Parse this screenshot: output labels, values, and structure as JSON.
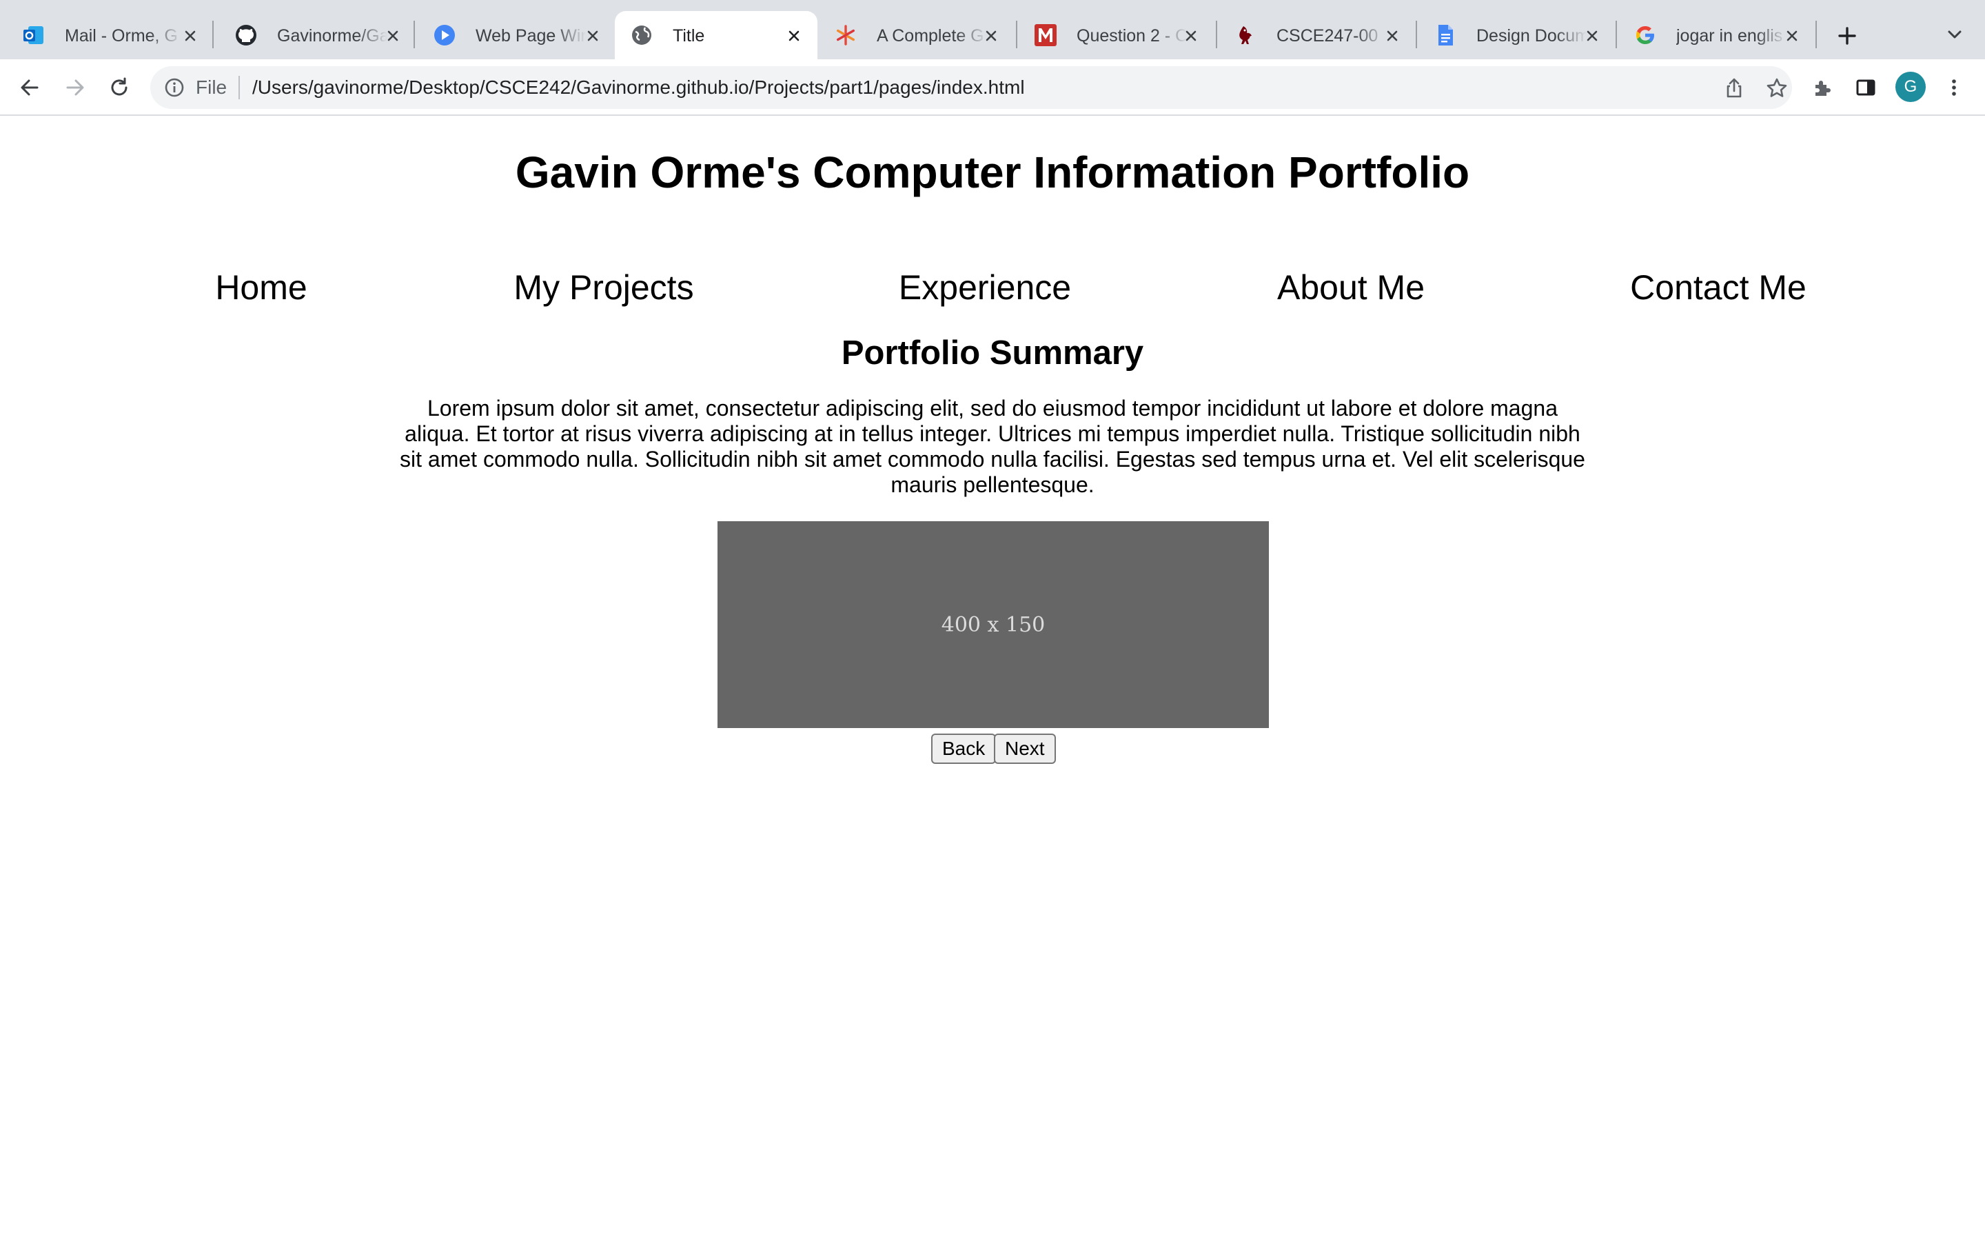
{
  "browser": {
    "tabs": [
      {
        "title": "Mail - Orme, G",
        "icon": "outlook-icon",
        "active": false
      },
      {
        "title": "Gavinorme/Ga",
        "icon": "github-icon",
        "active": false
      },
      {
        "title": "Web Page Wir",
        "icon": "play-icon",
        "active": false
      },
      {
        "title": "Title",
        "icon": "globe-icon",
        "active": true
      },
      {
        "title": "A Complete G",
        "icon": "asterisk-icon",
        "active": false
      },
      {
        "title": "Question 2 - C",
        "icon": "m-logo-icon",
        "active": false
      },
      {
        "title": "CSCE247-00",
        "icon": "gamecock-icon",
        "active": false
      },
      {
        "title": "Design Docum",
        "icon": "docs-icon",
        "active": false
      },
      {
        "title": "jogar in englis",
        "icon": "google-icon",
        "active": false
      }
    ],
    "address_bar": {
      "scheme_label": "File",
      "url": "/Users/gavinorme/Desktop/CSCE242/Gavinorme.github.io/Projects/part1/pages/index.html"
    },
    "profile_initial": "G",
    "colors": {
      "tabstrip": "#dee1e6",
      "omnibox": "#f1f3f4",
      "avatar": "#1e8e9e"
    }
  },
  "page": {
    "title": "Gavin Orme's Computer Information Portfolio",
    "nav": [
      "Home",
      "My Projects",
      "Experience",
      "About Me",
      "Contact Me"
    ],
    "section_title": "Portfolio Summary",
    "summary": "Lorem ipsum dolor sit amet, consectetur adipiscing elit, sed do eiusmod tempor incididunt ut labore et dolore magna aliqua. Et tortor at risus viverra adipiscing at in tellus integer. Ultrices mi tempus imperdiet nulla. Tristique sollicitudin nibh sit amet commodo nulla. Sollicitudin nibh sit amet commodo nulla facilisi. Egestas sed tempus urna et. Vel elit scelerisque mauris pellentesque.",
    "image_placeholder": "400 x 150",
    "buttons": {
      "back": "Back",
      "next": "Next"
    }
  }
}
